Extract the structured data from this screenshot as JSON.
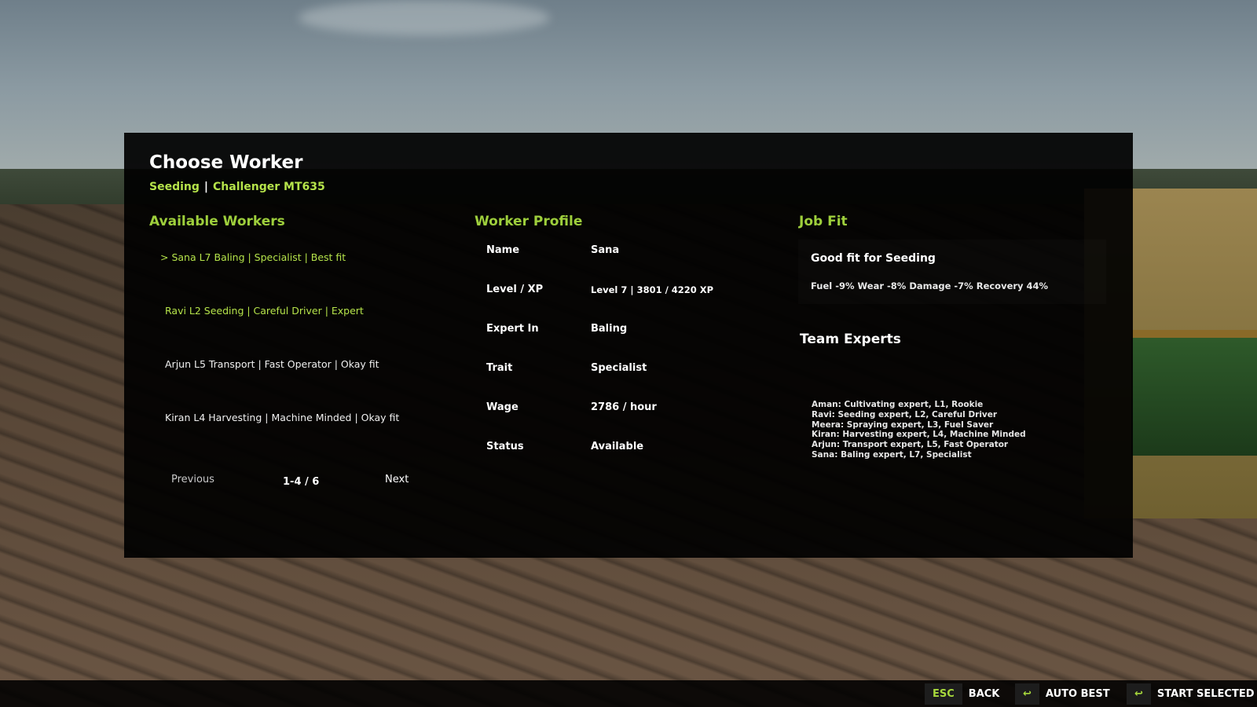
{
  "header": {
    "title": "Choose Worker",
    "task": "Seeding",
    "vehicle": "Challenger MT635"
  },
  "sections": {
    "available_workers": "Available Workers",
    "worker_profile": "Worker Profile",
    "job_fit": "Job Fit",
    "team_experts": "Team Experts"
  },
  "workers": [
    {
      "text": "> Sana  L7  Baling | Specialist | Best fit"
    },
    {
      "text": "Ravi  L2  Seeding | Careful Driver | Expert"
    },
    {
      "text": "Arjun  L5  Transport | Fast Operator | Okay fit"
    },
    {
      "text": "Kiran  L4  Harvesting | Machine Minded | Okay fit"
    }
  ],
  "pager": {
    "previous": "Previous",
    "count": "1-4 / 6",
    "next": "Next"
  },
  "profile": [
    {
      "key": "Name",
      "value": "Sana"
    },
    {
      "key": "Level / XP",
      "value": "Level 7  |  3801 / 4220 XP"
    },
    {
      "key": "Expert In",
      "value": "Baling"
    },
    {
      "key": "Trait",
      "value": "Specialist"
    },
    {
      "key": "Wage",
      "value": "2786 / hour"
    },
    {
      "key": "Status",
      "value": "Available"
    }
  ],
  "job_fit": {
    "title": "Good fit for Seeding",
    "stats": "Fuel -9%  Wear -8%  Damage -7%  Recovery 44%"
  },
  "team_experts": [
    "Aman: Cultivating expert, L1, Rookie",
    "Ravi: Seeding expert, L2, Careful Driver",
    "Meera: Spraying expert, L3, Fuel Saver",
    "Kiran: Harvesting expert, L4, Machine Minded",
    "Arjun: Transport expert, L5, Fast Operator",
    "Sana: Baling expert, L7, Specialist"
  ],
  "bottom_bar": {
    "back_key": "ESC",
    "back_label": "BACK",
    "auto_icon": "↩",
    "auto_label": "AUTO BEST",
    "start_icon": "↩",
    "start_label": "START SELECTED"
  },
  "colors": {
    "accent_green": "#9ecf3c",
    "highlight_green": "#b5e34a"
  }
}
